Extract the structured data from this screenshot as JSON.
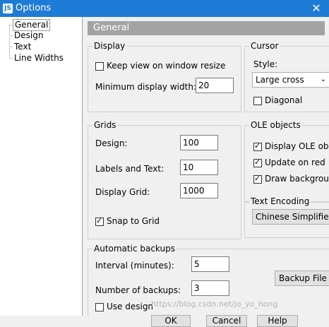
{
  "window": {
    "title": "Options",
    "close_glyph": "✕",
    "app_icon_text": "JS"
  },
  "tree": {
    "items": [
      {
        "label": "General",
        "selected": true
      },
      {
        "label": "Design"
      },
      {
        "label": "Text"
      },
      {
        "label": "Line Widths"
      }
    ]
  },
  "panel": {
    "header": "General"
  },
  "display": {
    "title": "Display",
    "keep_view_label": "Keep view on window resize",
    "keep_view_checked": false,
    "min_width_label": "Minimum display width:",
    "min_width_value": "20"
  },
  "cursor": {
    "title": "Cursor",
    "style_label": "Style:",
    "style_value": "Large cross",
    "diagonal_label": "Diagonal",
    "diagonal_checked": false
  },
  "grids": {
    "title": "Grids",
    "design_label": "Design:",
    "design_value": "100",
    "labels_label": "Labels and Text:",
    "labels_value": "10",
    "display_label": "Display Grid:",
    "display_value": "1000",
    "snap_label": "Snap to Grid",
    "snap_checked": true
  },
  "ole": {
    "title": "OLE objects",
    "display_label": "Display OLE ob",
    "update_label": "Update on red",
    "draw_label": "Draw backgrou"
  },
  "encoding": {
    "title": "Text Encoding",
    "value": "Chinese Simplifie"
  },
  "backups": {
    "title": "Automatic backups",
    "interval_label": "Interval (minutes):",
    "interval_value": "5",
    "number_label": "Number of backups:",
    "number_value": "3",
    "use_design_label": "Use design",
    "backup_button": "Backup File"
  },
  "buttons": {
    "ok": "OK",
    "cancel": "Cancel",
    "help": "Help"
  },
  "watermark": "https://blog.csdn.net/jo_yo_hong"
}
